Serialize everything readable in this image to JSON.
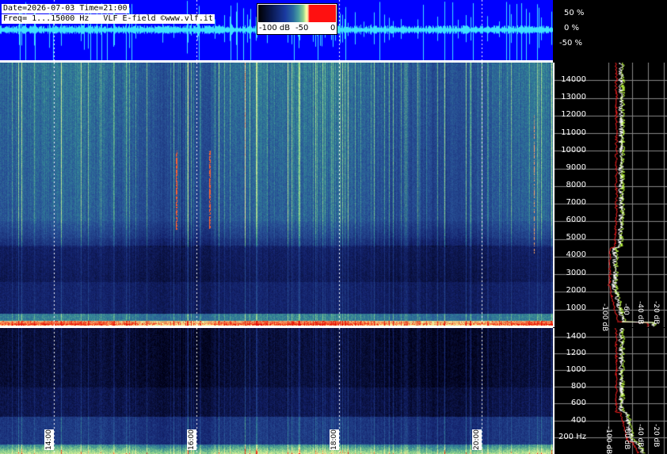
{
  "header": {
    "date_line": "Date=2026-07-03 Time=21:00",
    "freq_line": "Freq= 1...15000 Hz   VLF E-field ©www.vlf.it"
  },
  "colorbar": {
    "labels": [
      "-100 dB",
      "-50",
      "0"
    ]
  },
  "colors": {
    "waveform_bg": "#0000ff",
    "waveform_trace": "#40e0ff",
    "spectrum_avg": "#ff2020",
    "spectrum_peak": "#c0ff40"
  },
  "chart_data": [
    {
      "type": "line",
      "name": "waveform",
      "ylabel_ticks": [
        "50 %",
        "0 %",
        "-50 %"
      ],
      "yticks": [
        50,
        0,
        -50
      ],
      "ylim": [
        -100,
        100
      ]
    },
    {
      "type": "heatmap",
      "name": "spectrogram-full",
      "ylim": [
        0,
        15000
      ],
      "yticks": [
        1000,
        2000,
        3000,
        4000,
        5000,
        6000,
        7000,
        8000,
        9000,
        10000,
        11000,
        12000,
        13000,
        14000
      ],
      "ytick_labels": [
        "1000",
        "2000",
        "3000",
        "4000",
        "5000",
        "6000",
        "7000",
        "8000",
        "9000",
        "10000",
        "11000",
        "12000",
        "13000",
        "14000"
      ]
    },
    {
      "type": "line",
      "name": "spectrum-full",
      "xticks": [
        -100,
        -60,
        -40,
        -20
      ],
      "xtick_labels": [
        "-100 dB",
        "-60",
        "-40 dB",
        "-20 dB"
      ]
    },
    {
      "type": "heatmap",
      "name": "spectrogram-low",
      "ylim": [
        0,
        1500
      ],
      "yticks": [
        200,
        400,
        600,
        800,
        1000,
        1200,
        1400
      ],
      "ytick_labels": [
        "200 Hz",
        "400",
        "600",
        "800",
        "1000",
        "1200",
        "1400"
      ],
      "time_ticks": [
        "14:00",
        "16:00",
        "18:00",
        "20:00"
      ]
    },
    {
      "type": "line",
      "name": "spectrum-low",
      "xticks": [
        -100,
        -60,
        -40,
        -20
      ],
      "xtick_labels": [
        "-100 dB",
        "-60 dB",
        "-40 dB",
        "-20 dB"
      ]
    }
  ]
}
